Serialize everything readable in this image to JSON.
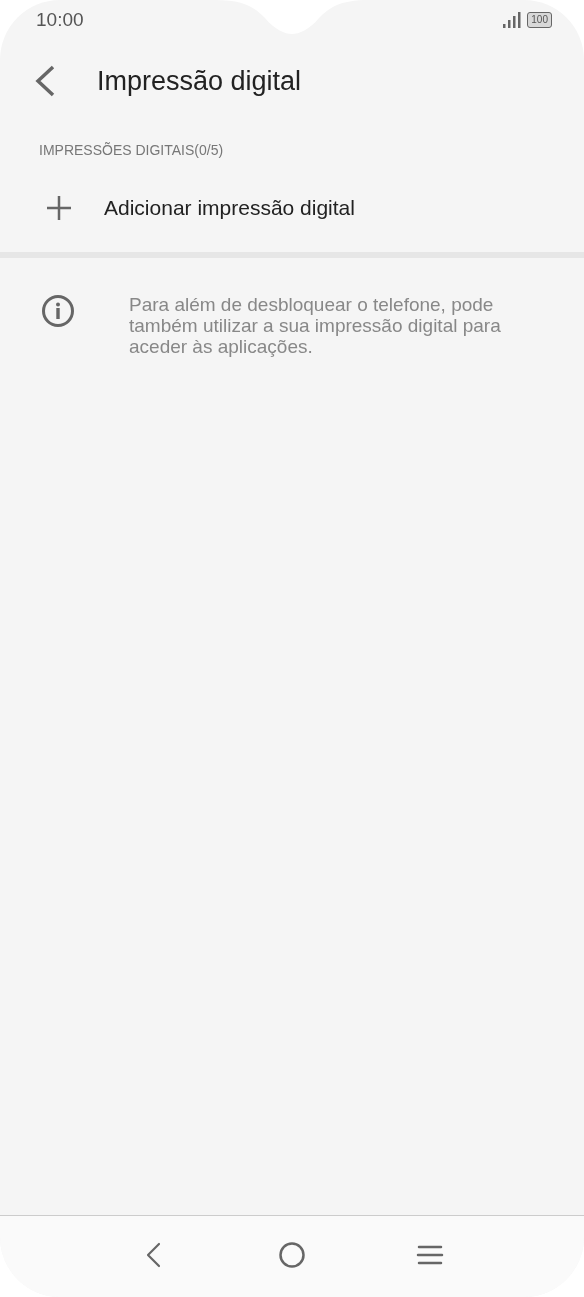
{
  "status_bar": {
    "time": "10:00",
    "battery": "100"
  },
  "header": {
    "title": "Impressão digital"
  },
  "section": {
    "label": "IMPRESSÕES DIGITAIS(0/5)"
  },
  "add_item": {
    "label": "Adicionar impressão digital"
  },
  "info": {
    "text": "Para além de desbloquear o telefone, pode também utilizar a sua impressão digital para aceder às aplicações."
  }
}
